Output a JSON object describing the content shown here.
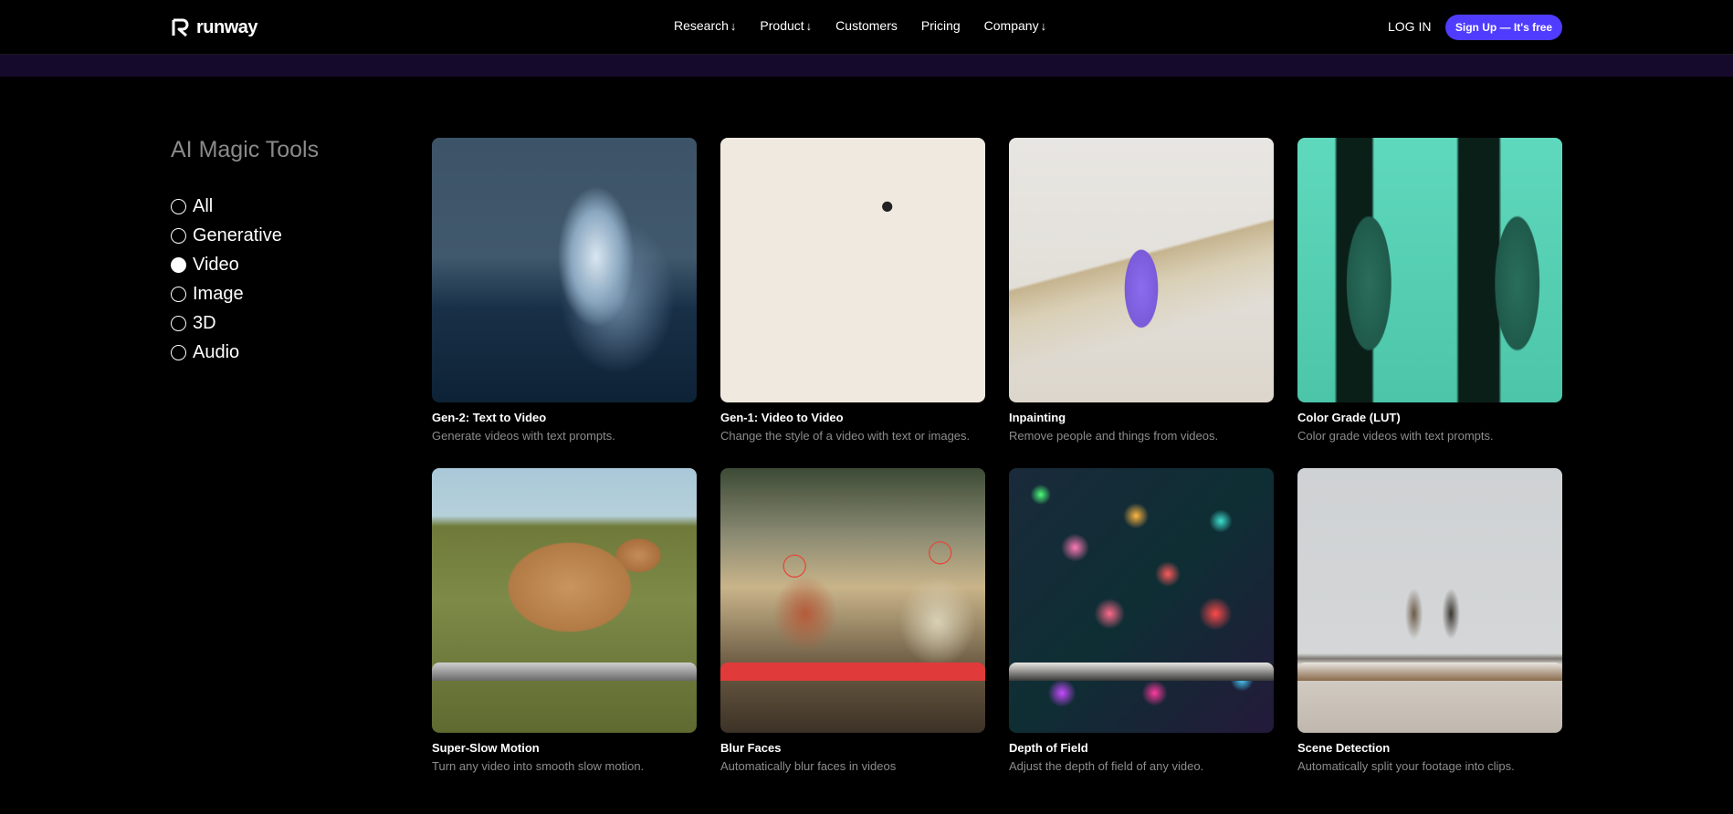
{
  "header": {
    "logo_text": "runway",
    "nav": [
      {
        "label": "Research",
        "arrow": "↓"
      },
      {
        "label": "Product",
        "arrow": "↓"
      },
      {
        "label": "Customers",
        "arrow": ""
      },
      {
        "label": "Pricing",
        "arrow": ""
      },
      {
        "label": "Company",
        "arrow": "↓"
      }
    ],
    "login_label": "LOG IN",
    "signup_label": "Sign Up — It's free",
    "accent": "#4f3cff"
  },
  "sidebar": {
    "title": "AI Magic Tools",
    "filters": [
      {
        "label": "All",
        "selected": false
      },
      {
        "label": "Generative",
        "selected": false
      },
      {
        "label": "Video",
        "selected": true
      },
      {
        "label": "Image",
        "selected": false
      },
      {
        "label": "3D",
        "selected": false
      },
      {
        "label": "Audio",
        "selected": false
      }
    ]
  },
  "tools": [
    {
      "title": "Gen-2: Text to Video",
      "description": "Generate videos with text prompts.",
      "thumb": "wave"
    },
    {
      "title": "Gen-1: Video to Video",
      "description": "Change the style of a video with text or images.",
      "thumb": "clay"
    },
    {
      "title": "Inpainting",
      "description": "Remove people and things from videos.",
      "thumb": "sand"
    },
    {
      "title": "Color Grade (LUT)",
      "description": "Color grade videos with text prompts.",
      "thumb": "skate"
    },
    {
      "title": "Super-Slow Motion",
      "description": "Turn any video into smooth slow motion.",
      "thumb": "horse"
    },
    {
      "title": "Blur Faces",
      "description": "Automatically blur faces in videos",
      "thumb": "room"
    },
    {
      "title": "Depth of Field",
      "description": "Adjust the depth of field of any video.",
      "thumb": "bokeh"
    },
    {
      "title": "Scene Detection",
      "description": "Automatically split your footage into clips.",
      "thumb": "scene"
    }
  ]
}
